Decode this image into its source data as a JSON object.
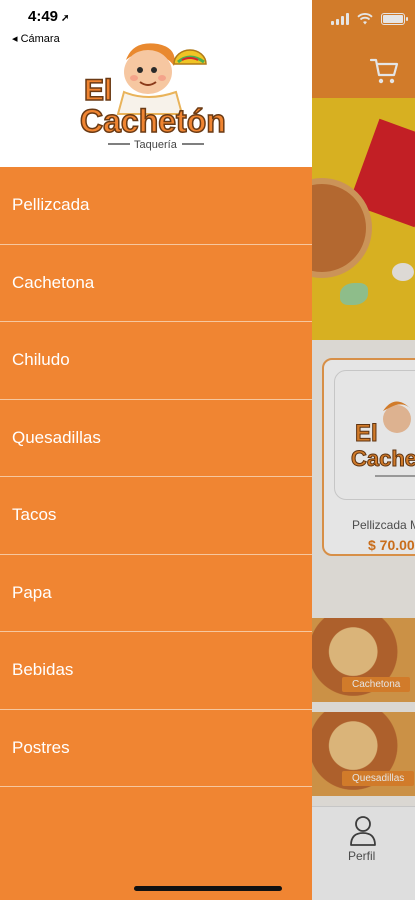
{
  "status_bar": {
    "time": "4:49",
    "back_app": "◂ Cámara"
  },
  "brand": {
    "name_line1": "El",
    "name_line2": "Cachetón",
    "tagline": "Taquería"
  },
  "menu": {
    "items": [
      {
        "label": "Pellizcada"
      },
      {
        "label": "Cachetona"
      },
      {
        "label": "Chiludo"
      },
      {
        "label": "Quesadillas"
      },
      {
        "label": "Tacos"
      },
      {
        "label": "Papa"
      },
      {
        "label": "Bebidas"
      },
      {
        "label": "Postres"
      }
    ]
  },
  "background": {
    "card": {
      "name": "Pellizcada M",
      "price": "$ 70.00"
    },
    "tiles": [
      {
        "label": "Cachetona"
      },
      {
        "label": "Quesadillas"
      }
    ],
    "tabbar": {
      "profile_label": "Perfil"
    }
  },
  "colors": {
    "accent": "#f08532",
    "header": "#e9892f",
    "hero": "#f0c425",
    "price": "#e07a1f"
  },
  "icons": [
    "cart-icon",
    "profile-icon",
    "signal-icon",
    "wifi-icon",
    "battery-icon",
    "location-arrow-icon"
  ]
}
